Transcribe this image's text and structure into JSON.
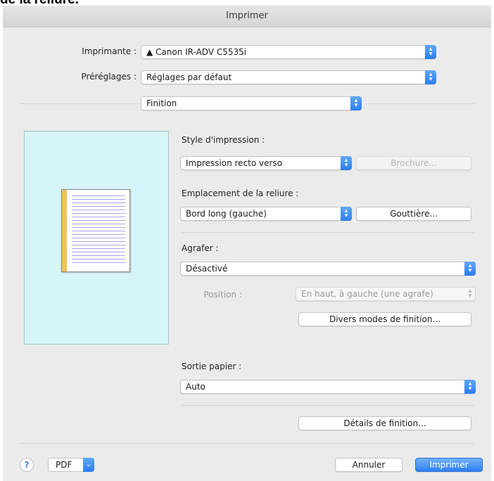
{
  "page_heading": "de la reliure.",
  "dialog": {
    "title": "Imprimer",
    "printer": {
      "label": "Imprimante :",
      "value": "▲ Canon IR-ADV C5535i"
    },
    "presets": {
      "label": "Préréglages :",
      "value": "Réglages par défaut"
    },
    "panel_select": {
      "value": "Finition"
    },
    "print_style": {
      "label": "Style d'impression :",
      "value": "Impression recto verso",
      "brochure_label": "Brochure..."
    },
    "binding_location": {
      "label": "Emplacement de la reliure :",
      "value": "Bord long (gauche)",
      "gutter_label": "Gouttière..."
    },
    "staple": {
      "label": "Agrafer :",
      "value": "Désactivé",
      "position_label": "Position :",
      "position_value": "En haut, à gauche (une agrafe)",
      "modes_label": "Divers modes de finition..."
    },
    "paper_output": {
      "label": "Sortie papier :",
      "value": "Auto"
    },
    "finish_details_label": "Détails de finition...",
    "footer": {
      "help": "?",
      "pdf": "PDF",
      "cancel": "Annuler",
      "print": "Imprimer"
    }
  },
  "colors": {
    "accent": "#2a7ef0",
    "preview_bg": "#d6f5f8",
    "binding": "#f0c25a"
  }
}
